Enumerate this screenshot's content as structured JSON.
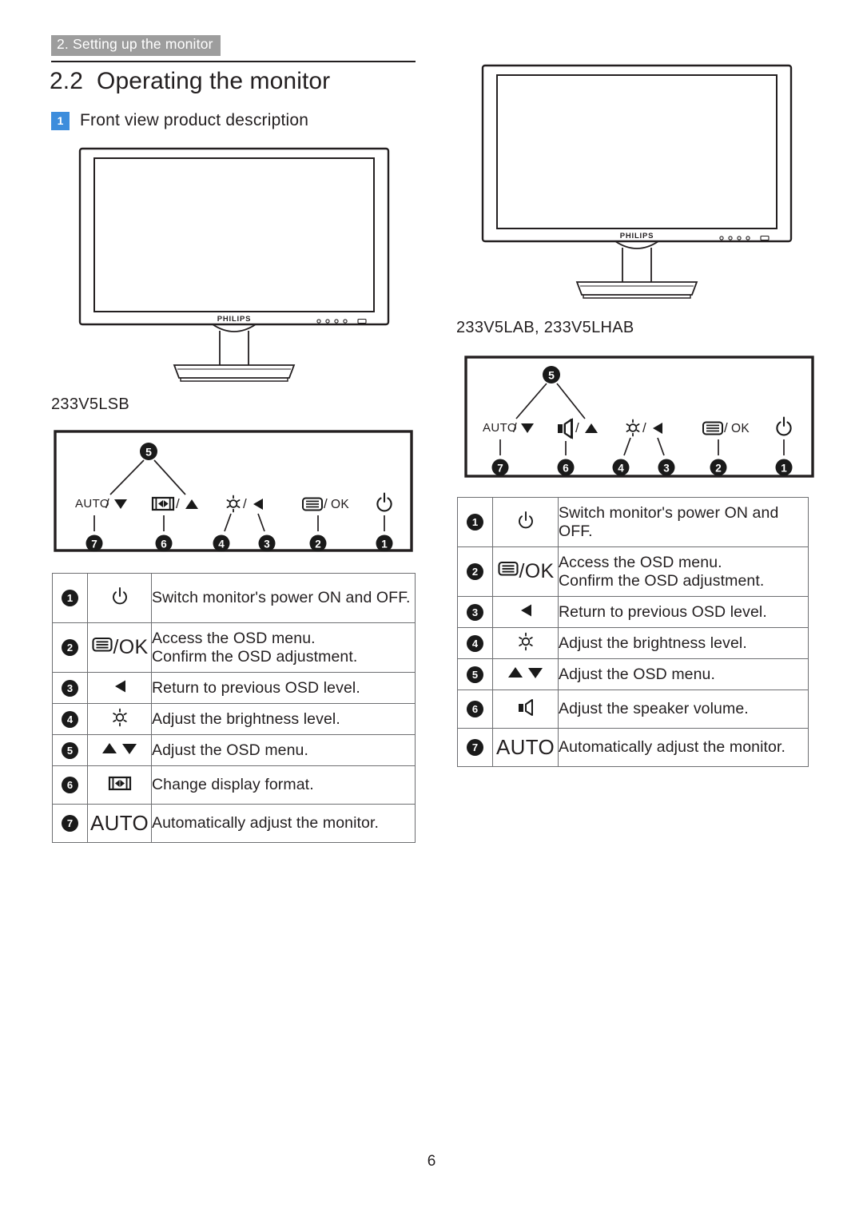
{
  "header": {
    "banner": "2. Setting up the monitor",
    "section_number": "2.2",
    "section_title": "Operating the monitor",
    "subsection_badge": "1",
    "subsection_title": "Front view product description"
  },
  "left_column": {
    "monitor_brand": "PHILIPS",
    "model_label": "233V5LSB",
    "panel": {
      "callouts": [
        {
          "id": "7",
          "label": "AUTO /",
          "icon": "triangle-down-icon"
        },
        {
          "id": "6",
          "label": "",
          "icon": "display-format-icon",
          "suffix": "/",
          "icon2": "triangle-up-icon"
        },
        {
          "id": "5",
          "label": "",
          "icon": "up-down-bracket"
        },
        {
          "id": "4",
          "label": "",
          "icon": "brightness-icon",
          "suffix": "/"
        },
        {
          "id": "3",
          "label": "",
          "icon": "triangle-left-icon"
        },
        {
          "id": "2",
          "label": "/ OK",
          "icon": "menu-icon"
        },
        {
          "id": "1",
          "label": "",
          "icon": "power-icon"
        }
      ]
    },
    "table": {
      "rows": [
        {
          "num": "1",
          "icon": "power-icon",
          "icon_text": "",
          "desc": "Switch monitor's power ON and OFF."
        },
        {
          "num": "2",
          "icon": "menu-icon",
          "icon_text": "/OK",
          "desc_line1": "Access the OSD menu.",
          "desc_line2": "Confirm the OSD adjustment."
        },
        {
          "num": "3",
          "icon": "triangle-left-icon",
          "icon_text": "",
          "desc": "Return to previous OSD level."
        },
        {
          "num": "4",
          "icon": "brightness-icon",
          "icon_text": "",
          "desc": "Adjust the brightness level."
        },
        {
          "num": "5",
          "icon": "up-down-arrows-icon",
          "icon_text": "",
          "desc": "Adjust the OSD menu."
        },
        {
          "num": "6",
          "icon": "display-format-icon",
          "icon_text": "",
          "desc": "Change display format."
        },
        {
          "num": "7",
          "icon": "auto-text",
          "icon_text": "AUTO",
          "desc": "Automatically adjust the monitor."
        }
      ]
    }
  },
  "right_column": {
    "monitor_brand": "PHILIPS",
    "model_label": "233V5LAB, 233V5LHAB",
    "panel": {
      "callouts": [
        {
          "id": "7",
          "label": "AUTO /",
          "icon": "triangle-down-icon"
        },
        {
          "id": "6",
          "label": "",
          "icon": "speaker-icon",
          "suffix": "/",
          "icon2": "triangle-up-icon"
        },
        {
          "id": "5",
          "label": "",
          "icon": "up-down-bracket"
        },
        {
          "id": "4",
          "label": "",
          "icon": "brightness-icon",
          "suffix": "/"
        },
        {
          "id": "3",
          "label": "",
          "icon": "triangle-left-icon"
        },
        {
          "id": "2",
          "label": "/ OK",
          "icon": "menu-icon"
        },
        {
          "id": "1",
          "label": "",
          "icon": "power-icon"
        }
      ]
    },
    "table": {
      "rows": [
        {
          "num": "1",
          "icon": "power-icon",
          "icon_text": "",
          "desc": "Switch monitor's power ON and OFF."
        },
        {
          "num": "2",
          "icon": "menu-icon",
          "icon_text": "/OK",
          "desc_line1": "Access the OSD menu.",
          "desc_line2": "Confirm the OSD adjustment."
        },
        {
          "num": "3",
          "icon": "triangle-left-icon",
          "icon_text": "",
          "desc": "Return to previous OSD level."
        },
        {
          "num": "4",
          "icon": "brightness-icon",
          "icon_text": "",
          "desc": "Adjust the brightness level."
        },
        {
          "num": "5",
          "icon": "up-down-arrows-icon",
          "icon_text": "",
          "desc": "Adjust the OSD menu."
        },
        {
          "num": "6",
          "icon": "speaker-icon",
          "icon_text": "",
          "desc": "Adjust the speaker volume."
        },
        {
          "num": "7",
          "icon": "auto-text",
          "icon_text": "AUTO",
          "desc": "Automatically adjust the monitor."
        }
      ]
    }
  },
  "panel_labels": {
    "auto": "AUTO",
    "slash": "/",
    "ok": "/OK"
  },
  "footer": {
    "page_number": "6"
  },
  "colors": {
    "banner_gray": "#9d9d9d",
    "badge_blue": "#3d8ddc",
    "ink": "#231f20",
    "table_border": "#6d6e71"
  }
}
